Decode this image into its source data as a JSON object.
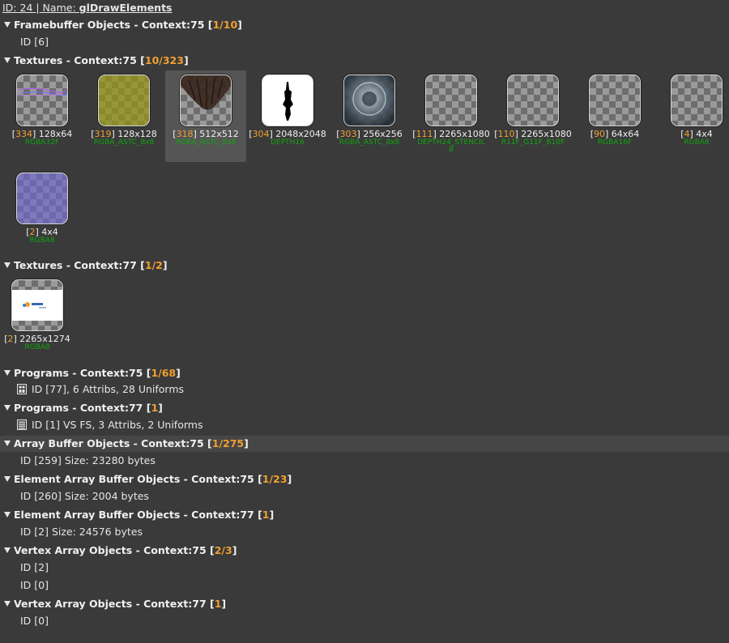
{
  "header": {
    "id_label": "ID: 24 | Name: ",
    "name": "glDrawElements"
  },
  "colors": {
    "count": "#f0a030",
    "format": "#11a511",
    "background": "#3a3a3a",
    "highlight_row": "#464646"
  },
  "sections": {
    "fbo75": {
      "title": "Framebuffer Objects - Context:75 [",
      "count": "1/10",
      "close": "]",
      "items": [
        "ID [6]"
      ]
    },
    "tex75": {
      "title": "Textures - Context:75 [",
      "count": "10/323",
      "close": "]"
    },
    "tex77": {
      "title": "Textures - Context:77 [",
      "count": "1/2",
      "close": "]"
    },
    "prog75": {
      "title": "Programs - Context:75 [",
      "count": "1/68",
      "close": "]",
      "items": [
        "ID [77], 6 Attribs, 28 Uniforms"
      ],
      "icon": "program-icon"
    },
    "prog77": {
      "title": "Programs - Context:77 [",
      "count": "1",
      "close": "]",
      "items": [
        "ID [1] VS FS, 3 Attribs, 2 Uniforms"
      ],
      "icon": "program-list-icon"
    },
    "abo75": {
      "title": "Array Buffer Objects - Context:75 [",
      "count": "1/275",
      "close": "]",
      "items": [
        "ID [259] Size: 23280 bytes"
      ]
    },
    "eabo75": {
      "title": "Element Array Buffer Objects - Context:75 [",
      "count": "1/23",
      "close": "]",
      "items": [
        "ID [260] Size: 2004 bytes"
      ]
    },
    "eabo77": {
      "title": "Element Array Buffer Objects - Context:77 [",
      "count": "1",
      "close": "]",
      "items": [
        "ID [2] Size: 24576 bytes"
      ]
    },
    "vao75": {
      "title": "Vertex Array Objects - Context:75 [",
      "count": "2/3",
      "close": "]",
      "items": [
        "ID [2]",
        "ID [0]"
      ]
    },
    "vao77": {
      "title": "Vertex Array Objects - Context:77 [",
      "count": "1",
      "close": "]",
      "items": [
        "ID [0]"
      ]
    }
  },
  "textures75": [
    {
      "id": "334",
      "size": "128x64",
      "format": "RGBA32F",
      "overlay": "purple-lines"
    },
    {
      "id": "319",
      "size": "128x128",
      "format": "RGBA_ASTC_8x8",
      "overlay": "olive"
    },
    {
      "id": "318",
      "size": "512x512",
      "format": "RGBA_ASTC_8x8",
      "overlay": "hair",
      "selected": true
    },
    {
      "id": "304",
      "size": "2048x2048",
      "format": "DEPTH16",
      "overlay": "depth"
    },
    {
      "id": "303",
      "size": "256x256",
      "format": "RGBA_ASTC_8x8",
      "overlay": "sphere"
    },
    {
      "id": "111",
      "size": "2265x1080",
      "format": "DEPTH24_STENCIL8",
      "overlay": "none"
    },
    {
      "id": "110",
      "size": "2265x1080",
      "format": "R11F_G11F_B10F",
      "overlay": "none"
    },
    {
      "id": "90",
      "size": "64x64",
      "format": "RGBA16F",
      "overlay": "none"
    },
    {
      "id": "4",
      "size": "4x4",
      "format": "RGBA8",
      "overlay": "none"
    },
    {
      "id": "2",
      "size": "4x4",
      "format": "RGBA8",
      "overlay": "blue"
    }
  ],
  "textures77": [
    {
      "id": "2",
      "size": "2265x1274",
      "format": "RGBA8",
      "overlay": "splash"
    }
  ]
}
